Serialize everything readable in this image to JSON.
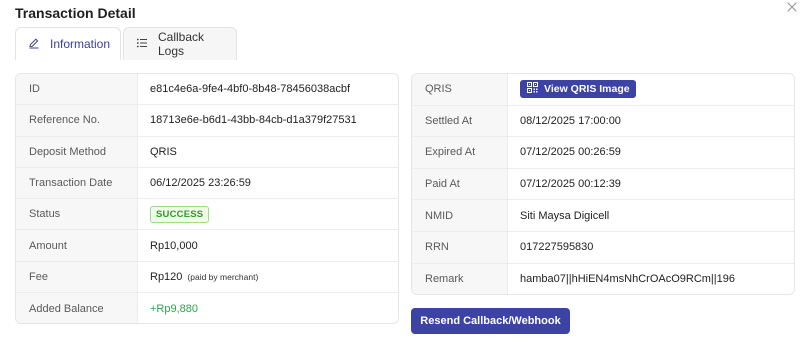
{
  "modal": {
    "title": "Transaction Detail"
  },
  "tabs": [
    {
      "label": "Information",
      "icon": "pencil-icon",
      "active": true
    },
    {
      "label": "Callback Logs",
      "icon": "list-icon",
      "active": false
    }
  ],
  "left": {
    "rows": [
      {
        "label": "ID",
        "value": "e81c4e6a-9fe4-4bf0-8b48-78456038acbf"
      },
      {
        "label": "Reference No.",
        "value": "18713e6e-b6d1-43bb-84cb-d1a379f27531"
      },
      {
        "label": "Deposit Method",
        "value": "QRIS"
      },
      {
        "label": "Transaction Date",
        "value": "06/12/2025 23:26:59"
      },
      {
        "label": "Status",
        "value": "SUCCESS"
      },
      {
        "label": "Amount",
        "value": "Rp10,000"
      },
      {
        "label": "Fee",
        "value": "Rp120",
        "note": "(paid by merchant)"
      },
      {
        "label": "Added Balance",
        "value": "+Rp9,880"
      }
    ]
  },
  "right": {
    "rows": [
      {
        "label": "QRIS",
        "button_label": "View QRIS Image"
      },
      {
        "label": "Settled At",
        "value": "08/12/2025 17:00:00"
      },
      {
        "label": "Expired At",
        "value": "07/12/2025 00:26:59"
      },
      {
        "label": "Paid At",
        "value": "07/12/2025 00:12:39"
      },
      {
        "label": "NMID",
        "value": "Siti Maysa Digicell"
      },
      {
        "label": "RRN",
        "value": "017227595830"
      },
      {
        "label": "Remark",
        "value": "hamba07||hHiEN4msNhCrOAcO9RCm||196"
      }
    ]
  },
  "actions": {
    "resend_label": "Resend Callback/Webhook"
  },
  "colors": {
    "primary": "#3d43a4",
    "success": "#2e9a2b",
    "positive": "#2fa34b"
  }
}
